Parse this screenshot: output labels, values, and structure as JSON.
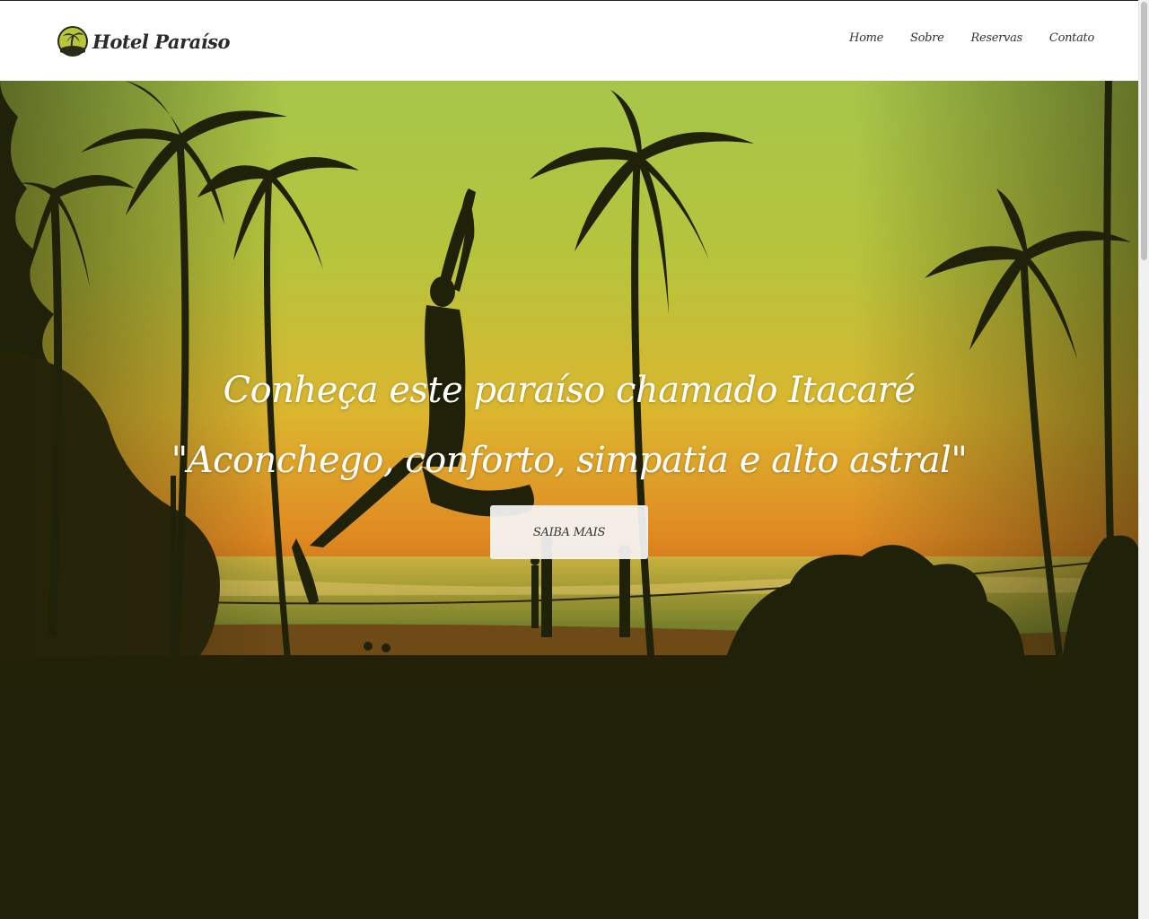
{
  "brand": {
    "name": "Hotel Paraíso",
    "logo_icon": "palm-tree-icon",
    "accent": "#b8c73a"
  },
  "nav": {
    "items": [
      {
        "label": "Home"
      },
      {
        "label": "Sobre"
      },
      {
        "label": "Reservas"
      },
      {
        "label": "Contato"
      }
    ]
  },
  "hero": {
    "title": "Conheça este paraíso chamado Itacaré",
    "quote": "\"Aconchego, conforto, simpatia e alto astral\"",
    "button_label": "SAIBA MAIS",
    "overlay_colors": {
      "sky_top": "#9ec23f",
      "sky_mid": "#e0b52c",
      "horizon": "#d77a1e",
      "silhouette": "#1f2108"
    }
  }
}
